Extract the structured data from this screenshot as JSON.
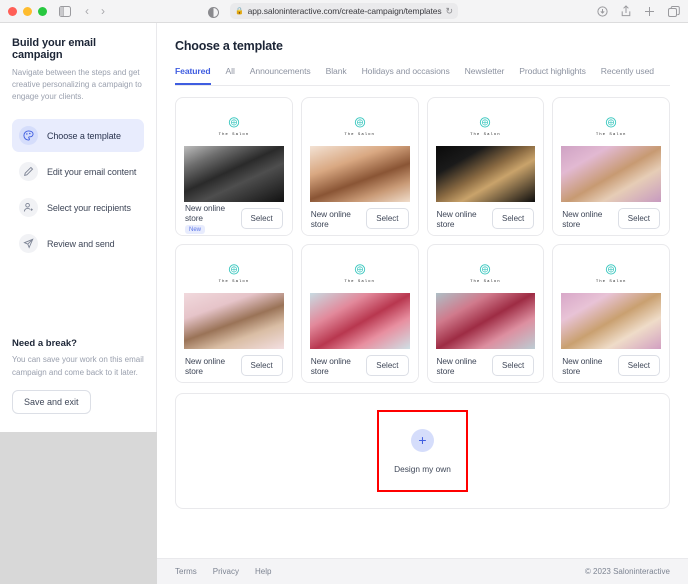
{
  "browser": {
    "url": "app.saloninteractive.com/create-campaign/templates",
    "lock_icon": "lock-icon",
    "reload_icon": "reload-icon",
    "appearance_icon": "appearance-icon",
    "sidebar_toggle_icon": "sidebar-toggle-icon",
    "back_icon": "‹",
    "forward_icon": "›",
    "downloads_icon": "downloads-icon",
    "share_icon": "share-icon",
    "new_tab_icon": "plus-icon",
    "tabs_icon": "tab-overview-icon"
  },
  "sidebar": {
    "title": "Build your email campaign",
    "subtitle": "Navigate between the steps and get creative personalizing a campaign to engage your clients.",
    "steps": [
      {
        "label": "Choose a template",
        "icon": "palette-icon",
        "active": true
      },
      {
        "label": "Edit your email content",
        "icon": "pencil-icon",
        "active": false
      },
      {
        "label": "Select your recipients",
        "icon": "person-icon",
        "active": false
      },
      {
        "label": "Review and send",
        "icon": "paper-plane-icon",
        "active": false
      }
    ],
    "break": {
      "title": "Need a break?",
      "text": "You can save your work on this email campaign and come back to it later.",
      "button": "Save and exit"
    }
  },
  "main": {
    "title": "Choose a template",
    "tabs": [
      {
        "label": "Featured",
        "active": true
      },
      {
        "label": "All",
        "active": false
      },
      {
        "label": "Announcements",
        "active": false
      },
      {
        "label": "Blank",
        "active": false
      },
      {
        "label": "Holidays and occasions",
        "active": false
      },
      {
        "label": "Newsletter",
        "active": false
      },
      {
        "label": "Product highlights",
        "active": false
      },
      {
        "label": "Recently used",
        "active": false
      }
    ],
    "brand_name": "The Salon",
    "select_label": "Select",
    "templates": [
      {
        "title": "New online store",
        "badge": "New",
        "img": "img1",
        "select": "Select"
      },
      {
        "title": "New online store",
        "badge": "",
        "img": "img2",
        "select": "Select"
      },
      {
        "title": "New online store",
        "badge": "",
        "img": "img3",
        "select": "Select"
      },
      {
        "title": "New online store",
        "badge": "",
        "img": "img4",
        "select": "Select"
      },
      {
        "title": "New online store",
        "badge": "",
        "img": "img5",
        "select": "Select"
      },
      {
        "title": "New online store",
        "badge": "",
        "img": "img6",
        "select": "Select"
      },
      {
        "title": "New online store",
        "badge": "",
        "img": "img7",
        "select": "Select"
      },
      {
        "title": "New online store",
        "badge": "",
        "img": "img8",
        "select": "Select"
      }
    ],
    "design_own": {
      "label": "Design my own",
      "plus_icon": "plus-icon",
      "highlight_color": "#ff0000"
    }
  },
  "footer": {
    "links": [
      "Terms",
      "Privacy",
      "Help"
    ],
    "copyright": "© 2023 Saloninteractive"
  },
  "colors": {
    "accent": "#3f5de0",
    "accent_soft": "#e8ecfd",
    "logo_teal": "#3ec8c0",
    "highlight": "#ff0000"
  }
}
